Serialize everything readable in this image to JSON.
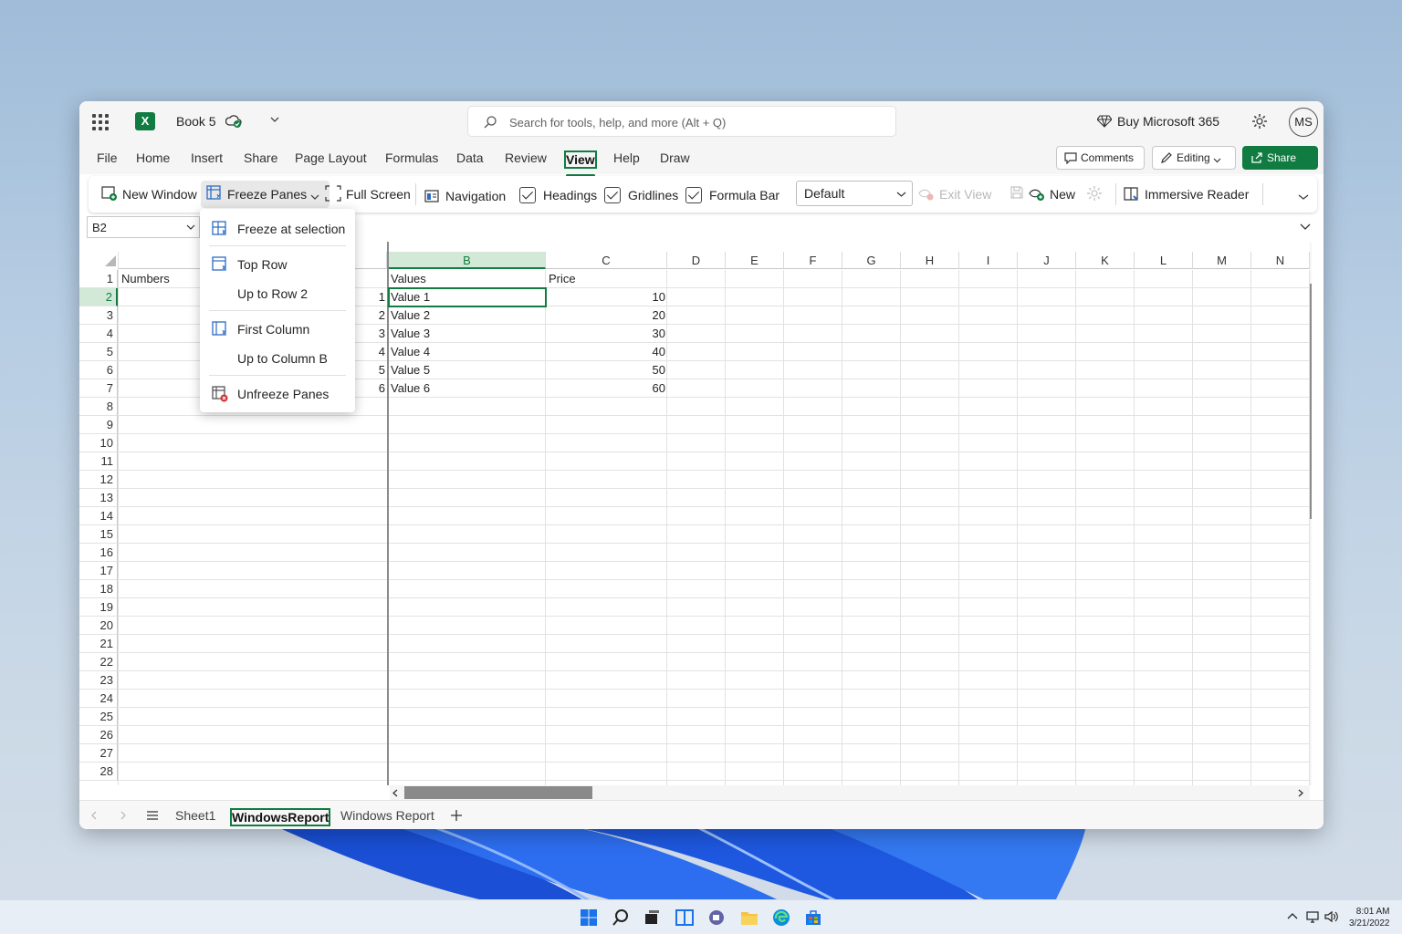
{
  "titlebar": {
    "doc_name": "Book 5",
    "search_placeholder": "Search for tools, help, and more (Alt + Q)",
    "buy": "Buy Microsoft 365",
    "avatar": "MS"
  },
  "menubar": {
    "tabs": [
      "File",
      "Home",
      "Insert",
      "Share",
      "Page Layout",
      "Formulas",
      "Data",
      "Review",
      "View",
      "Help",
      "Draw"
    ],
    "active_tab": "View",
    "comments": "Comments",
    "editing": "Editing",
    "share": "Share"
  },
  "ribbon": {
    "new_window": "New Window",
    "freeze_panes": "Freeze Panes",
    "full_screen": "Full Screen",
    "navigation": "Navigation",
    "headings": "Headings",
    "gridlines": "Gridlines",
    "formula_bar": "Formula Bar",
    "view_select": "Default",
    "exit_view": "Exit View",
    "new": "New",
    "immersive_reader": "Immersive Reader"
  },
  "namebox": "B2",
  "freeze_menu": {
    "items": [
      "Freeze at selection",
      "Top Row",
      "Up to Row 2",
      "First Column",
      "Up to Column B",
      "Unfreeze Panes"
    ]
  },
  "sheet": {
    "columns": [
      "B",
      "C",
      "D",
      "E",
      "F",
      "G",
      "H",
      "I",
      "J",
      "K",
      "L",
      "M",
      "N"
    ],
    "rows": [
      "1",
      "2",
      "3",
      "4",
      "5",
      "6",
      "7",
      "8",
      "9",
      "10",
      "11",
      "12",
      "13",
      "14",
      "15",
      "16",
      "17",
      "18",
      "19",
      "20",
      "21",
      "22",
      "23",
      "24",
      "25",
      "26",
      "27",
      "28"
    ],
    "a_header": "Numbers",
    "b_header": "Values",
    "c_header": "Price",
    "a_values": [
      "1",
      "2",
      "3",
      "4",
      "5",
      "6"
    ],
    "b_values": [
      "Value 1",
      "Value 2",
      "Value 3",
      "Value 4",
      "Value 5",
      "Value 6"
    ],
    "c_values": [
      "10",
      "20",
      "30",
      "40",
      "50",
      "60"
    ]
  },
  "sheet_tabs": [
    "Sheet1",
    "WindowsReport",
    "Windows Report"
  ],
  "active_sheet": "WindowsReport",
  "taskbar": {
    "time": "8:01 AM",
    "date": "3/21/2022"
  },
  "colors": {
    "accent": "#107c41",
    "selection_fill": "#d2e9d8"
  }
}
